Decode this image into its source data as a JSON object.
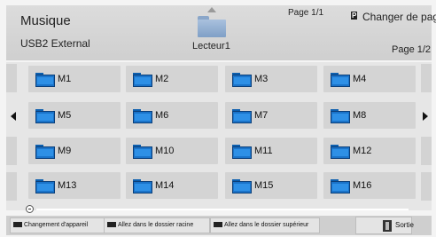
{
  "header": {
    "title": "Musique",
    "device": "USB2 External",
    "folder_label": "Lecteur1",
    "page_top": "Page 1/1",
    "p_badge": "P",
    "change_page": "Changer de page",
    "page_right": "Page 1/2",
    "up_icon": "triangle-up-icon",
    "folder_icon": "folder-icon"
  },
  "grid": {
    "items": [
      {
        "label": "M1"
      },
      {
        "label": "M2"
      },
      {
        "label": "M3"
      },
      {
        "label": "M4"
      },
      {
        "label": "M5"
      },
      {
        "label": "M6"
      },
      {
        "label": "M7"
      },
      {
        "label": "M8"
      },
      {
        "label": "M9"
      },
      {
        "label": "M10"
      },
      {
        "label": "M11"
      },
      {
        "label": "M12"
      },
      {
        "label": "M13"
      },
      {
        "label": "M14"
      },
      {
        "label": "M15"
      },
      {
        "label": "M16"
      }
    ],
    "left_arrow_icon": "arrow-left-icon",
    "right_arrow_icon": "arrow-right-icon",
    "scroll_icon": "scroll-knob-icon"
  },
  "footer": {
    "buttons": [
      {
        "label": "Changement d'appareil"
      },
      {
        "label": "Allez dans le dossier racine"
      },
      {
        "label": "Allez dans le dossier supérieur"
      }
    ],
    "exit_label": "Sortie",
    "exit_icon": "exit-door-icon"
  },
  "colors": {
    "header_bg": "#d6d6d6",
    "tile_bg": "#d4d4d4",
    "folder_blue": "#1a73c9"
  }
}
